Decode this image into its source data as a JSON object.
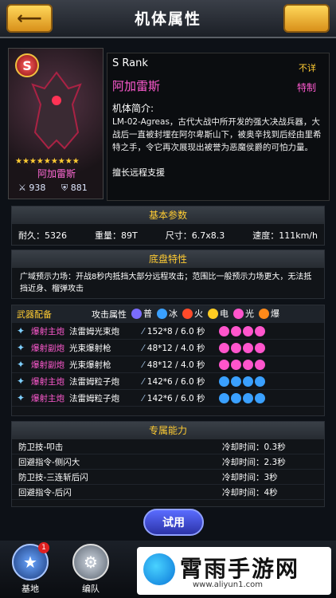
{
  "header": {
    "title": "机体属性",
    "back_icon": "back-arrow-icon",
    "right_icon": "gold-button-icon"
  },
  "portrait": {
    "rank_badge": "S",
    "stars": "★★★★★★★★★",
    "name": "阿加雷斯",
    "stat1": "938",
    "stat2": "881"
  },
  "info": {
    "rank": "S Rank",
    "unknown": "不详",
    "name": "阿加雷斯",
    "special": "特制",
    "intro_heading": "机体简介:",
    "intro": "LM-02-Agreas，古代大战中所开发的强大决战兵器，大战后一直被封埋在阿尔卑斯山下，被奥辛找到后经由里希特之手，令它再次展现出被誉为恶魔侯爵的可怕力量。",
    "skill": "擅长远程支援"
  },
  "basic": {
    "heading": "基本参数",
    "durability": "耐久：5326",
    "weight": "重量：89T",
    "size": "尺寸：6.7x8.3",
    "speed": "速度：111km/h"
  },
  "chassis": {
    "heading": "底盘特性",
    "text": "广域预示力场：开战8秒内抵挡大部分远程攻击；范围比一般预示力场更大，无法抵挡近身、榴弹攻击"
  },
  "weapons": {
    "heading": "武器配备",
    "attack_attr": "攻击属性",
    "elements": [
      {
        "label": "普",
        "color": "#7a6cff"
      },
      {
        "label": "冰",
        "color": "#3aa0ff"
      },
      {
        "label": "火",
        "color": "#ff4a2a"
      },
      {
        "label": "电",
        "color": "#ffcc22"
      },
      {
        "label": "光",
        "color": "#ff55cc"
      },
      {
        "label": "爆",
        "color": "#ff8a1a"
      }
    ],
    "rows": [
      {
        "type": "爆射主炮",
        "name": "法雷姆光束炮",
        "dmg": "152*8 / 6.0 秒",
        "elem_color": "#ff55cc"
      },
      {
        "type": "爆射副炮",
        "name": "光束爆射枪",
        "dmg": "48*12 / 4.0 秒",
        "elem_color": "#ff55cc"
      },
      {
        "type": "爆射副炮",
        "name": "光束爆射枪",
        "dmg": "48*12 / 4.0 秒",
        "elem_color": "#ff55cc"
      },
      {
        "type": "爆射主炮",
        "name": "法雷姆粒子炮",
        "dmg": "142*6 / 6.0 秒",
        "elem_color": "#3aa0ff"
      },
      {
        "type": "爆射主炮",
        "name": "法雷姆粒子炮",
        "dmg": "142*6 / 6.0 秒",
        "elem_color": "#3aa0ff"
      }
    ]
  },
  "exclusive": {
    "heading": "专属能力",
    "rows": [
      {
        "name": "防卫技-叩击",
        "cd": "冷却时间：0.3秒"
      },
      {
        "name": "回避指令-侧闪大",
        "cd": "冷却时间：2.3秒"
      },
      {
        "name": "防卫技-三连斩后闪",
        "cd": "冷却时间：3秒"
      },
      {
        "name": "回避指令-后闪",
        "cd": "冷却时间：4秒"
      }
    ]
  },
  "try_button": "试用",
  "nav": {
    "base_label": "基地",
    "team_label": "编队",
    "badge": "1"
  },
  "watermark": {
    "text": "霄雨手游网",
    "url": "www.aliyun1.com"
  }
}
